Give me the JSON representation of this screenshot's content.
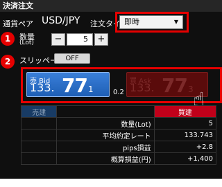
{
  "window": {
    "title": "決済注文"
  },
  "pair": {
    "label": "通貨ペア",
    "value": "USD/JPY"
  },
  "order_type": {
    "label": "注文タイプ",
    "selected": "即時"
  },
  "quantity": {
    "label_line1": "数量",
    "label_line2": "(Lot)",
    "minus": "−",
    "value": "5",
    "plus": "+"
  },
  "slippage": {
    "label": "スリッページ",
    "toggle": "OFF"
  },
  "markers": {
    "one": "1",
    "two": "2"
  },
  "sell": {
    "tag": "売 Bid",
    "big": "133.",
    "pip": "77",
    "frac": "1"
  },
  "buy": {
    "tag": "買 Ask",
    "big": "133.",
    "pip": "77",
    "frac": "3"
  },
  "spread": "0.2",
  "table": {
    "header_sell": "売建",
    "header_buy": "買建",
    "rows": [
      {
        "label": "数量(Lot)",
        "value": "5"
      },
      {
        "label": "平均約定レート",
        "value": "133.743"
      },
      {
        "label": "pips損益",
        "value": "+2.8"
      },
      {
        "label": "概算損益(円)",
        "value": "+1,400"
      }
    ]
  },
  "colors": {
    "accent_red": "#e60000",
    "sell_blue": "#1e5fb5",
    "buy_dark_red": "#5a0b0b"
  },
  "icons": {
    "cursor": "hand-pointer-icon",
    "dropdown": "caret-down-icon"
  }
}
